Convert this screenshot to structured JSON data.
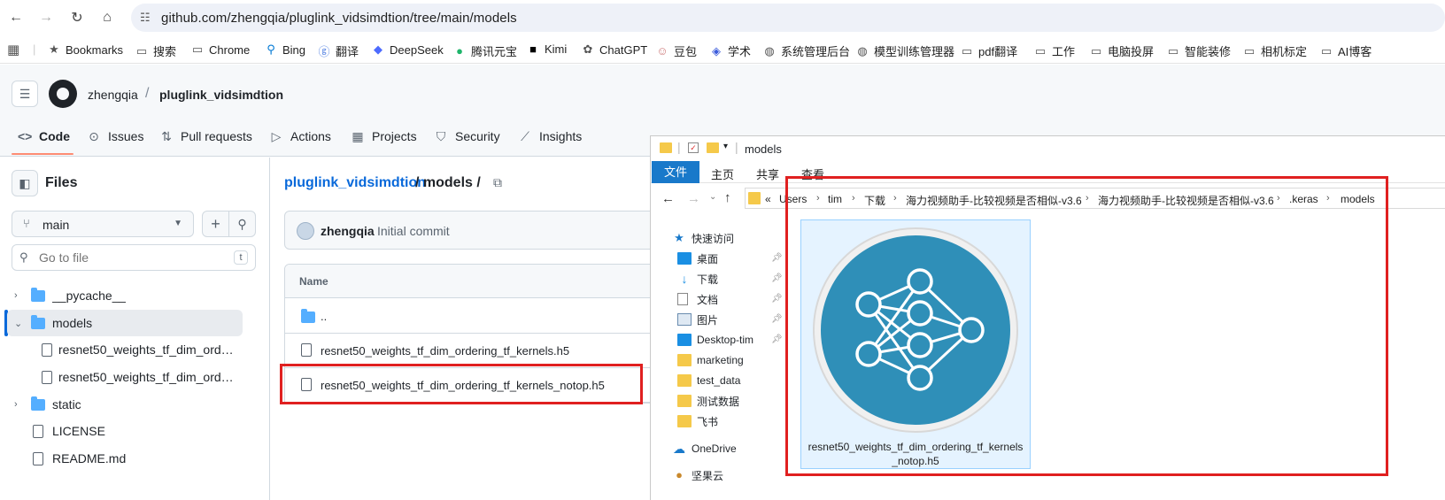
{
  "browser": {
    "url": "github.com/zhengqia/pluglink_vidsimdtion/tree/main/models",
    "bookmarks": [
      {
        "label": "Bookmarks",
        "icon": "star-icon"
      },
      {
        "label": "搜索",
        "icon": "folder-icon"
      },
      {
        "label": "Chrome",
        "icon": "folder-icon"
      },
      {
        "label": "Bing",
        "icon": "search-icon"
      },
      {
        "label": "翻译",
        "icon": "translate-icon"
      },
      {
        "label": "DeepSeek",
        "icon": "deepseek-icon"
      },
      {
        "label": "腾讯元宝",
        "icon": "yuanbao-icon"
      },
      {
        "label": "Kimi",
        "icon": "kimi-icon"
      },
      {
        "label": "ChatGPT",
        "icon": "chatgpt-icon"
      },
      {
        "label": "豆包",
        "icon": "doubao-icon"
      },
      {
        "label": "学术",
        "icon": "scholar-icon"
      },
      {
        "label": "系统管理后台",
        "icon": "globe-icon"
      },
      {
        "label": "模型训练管理器",
        "icon": "globe-icon"
      },
      {
        "label": "pdf翻译",
        "icon": "folder-icon"
      },
      {
        "label": "工作",
        "icon": "folder-icon"
      },
      {
        "label": "电脑投屏",
        "icon": "folder-icon"
      },
      {
        "label": "智能装修",
        "icon": "folder-icon"
      },
      {
        "label": "相机标定",
        "icon": "folder-icon"
      },
      {
        "label": "AI博客",
        "icon": "folder-icon"
      }
    ]
  },
  "github": {
    "owner": "zhengqia",
    "repo": "pluglink_vidsimdtion",
    "tabs": [
      "Code",
      "Issues",
      "Pull requests",
      "Actions",
      "Projects",
      "Security",
      "Insights"
    ],
    "sidebar": {
      "title": "Files",
      "branch": "main",
      "goto_placeholder": "Go to file",
      "goto_kbd": "t",
      "tree": [
        "__pycache__",
        "models",
        "resnet50_weights_tf_dim_ordering_tf_kernels.h5",
        "resnet50_weights_tf_dim_ordering_tf_kernels_notop.h5",
        "static",
        "LICENSE",
        "README.md"
      ]
    },
    "breadcrumb": {
      "repo": "pluglink_vidsimdtion",
      "rest": "/ models /"
    },
    "commit": {
      "author": "zhengqia",
      "message": "Initial commit"
    },
    "table": {
      "header": "Name",
      "rows": [
        "..",
        "resnet50_weights_tf_dim_ordering_tf_kernels.h5",
        "resnet50_weights_tf_dim_ordering_tf_kernels_notop.h5"
      ]
    }
  },
  "explorer": {
    "title": "models",
    "ribbon": [
      "文件",
      "主页",
      "共享",
      "查看"
    ],
    "path": [
      "«",
      "Users",
      "tim",
      "下载",
      "海力视频助手-比较视频是否相似-v3.6",
      "海力视频助手-比较视频是否相似-v3.6",
      ".keras",
      "models"
    ],
    "nav": [
      "快速访问",
      "桌面",
      "下载",
      "文档",
      "图片",
      "Desktop-tim",
      "marketing",
      "test_data",
      "测试数据",
      "飞书",
      "OneDrive",
      "坚果云"
    ],
    "file_label": "resnet50_weights_tf_dim_ordering_tf_kernels_notop.h5",
    "file_label_line1": "resnet50_weights_tf_dim_ordering_tf_kernels",
    "file_label_line2": "_notop.h5"
  },
  "colors": {
    "highlight": "#e02020",
    "gh_link": "#0969da",
    "ex_blue": "#1979ca"
  }
}
